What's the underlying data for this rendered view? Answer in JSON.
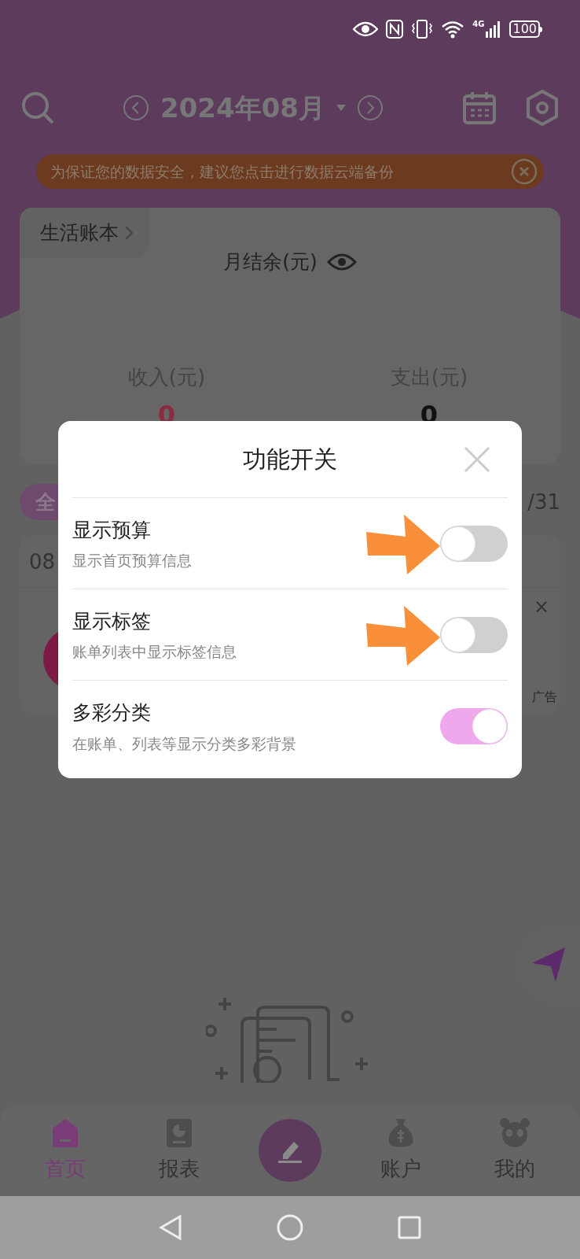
{
  "status_bar": {
    "network": "4G",
    "battery": "100"
  },
  "header": {
    "month": "2024年08月"
  },
  "backup_banner": {
    "text": "为保证您的数据安全，建议您点击进行数据云端备份"
  },
  "summary_card": {
    "book": "生活账本",
    "balance_label": "月结余(元)",
    "income_label": "收入(元)",
    "income": "0",
    "expense_label": "支出(元)",
    "expense": "0"
  },
  "filter": {
    "chip": "全",
    "date_range": "/31"
  },
  "list": {
    "date": "08",
    "ad_close": "×",
    "ad_label": "广告"
  },
  "dialog": {
    "title": "功能开关",
    "switches": [
      {
        "title": "显示预算",
        "subtitle": "显示首页预算信息",
        "on": false,
        "annotated": true
      },
      {
        "title": "显示标签",
        "subtitle": "账单列表中显示标签信息",
        "on": false,
        "annotated": true
      },
      {
        "title": "多彩分类",
        "subtitle": "在账单、列表等显示分类多彩背景",
        "on": true,
        "annotated": false
      }
    ]
  },
  "nav": [
    {
      "label": "首页",
      "selected": true
    },
    {
      "label": "报表",
      "selected": false
    },
    {
      "label": "账户",
      "selected": false
    },
    {
      "label": "我的",
      "selected": false
    }
  ]
}
